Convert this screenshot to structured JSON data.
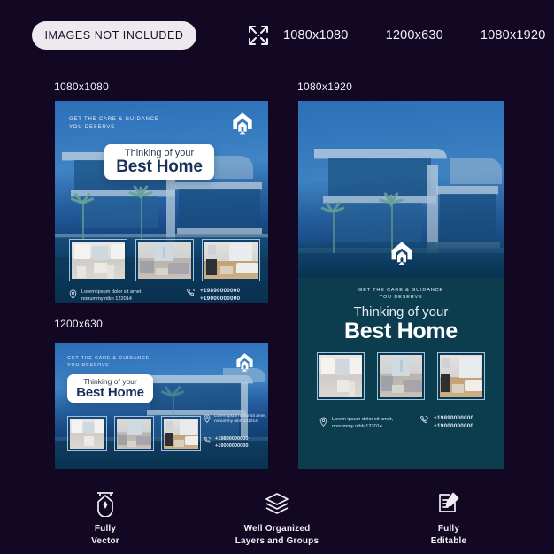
{
  "header": {
    "badge_label": "IMAGES NOT INCLUDED",
    "expand_icon": "expand-arrows-icon",
    "sizes": [
      "1080x1080",
      "1200x630",
      "1080x1920"
    ]
  },
  "captions": {
    "square": "1080x1080",
    "story": "1080x1920",
    "banner": "1200x630"
  },
  "creative": {
    "eyebrow_line1": "GET THE CARE & GUIDANCE",
    "eyebrow_line2": "YOU DESERVE",
    "headline_small": "Thinking of your",
    "headline_big": "Best Home",
    "address_line1": "Lorem ipsum dolor sit amet,",
    "address_line2": "nonummy nibh 122014",
    "phone_line1": "+19890000000",
    "phone_line2": "+19000000000",
    "location_icon": "location-pin-icon",
    "phone_icon": "phone-icon",
    "logo_icon": "building-chevron-logo-icon",
    "thumb_labels": [
      "kitchen-interior-thumbnail",
      "living-room-interior-thumbnail",
      "lounge-interior-thumbnail"
    ]
  },
  "features": [
    {
      "icon": "pen-tool-icon",
      "label_line1": "Fully",
      "label_line2": "Vector"
    },
    {
      "icon": "layers-stack-icon",
      "label_line1": "Well Organized",
      "label_line2": "Layers and Groups"
    },
    {
      "icon": "edit-document-icon",
      "label_line1": "Fully",
      "label_line2": "Editable"
    }
  ],
  "colors": {
    "background": "#120823",
    "badge_bg": "#eceaee",
    "sky_blue": "#3b82c9",
    "teal_panel": "#0b3d4e",
    "headline_navy": "#16305a",
    "thumb_border": "#9fc4e2"
  }
}
